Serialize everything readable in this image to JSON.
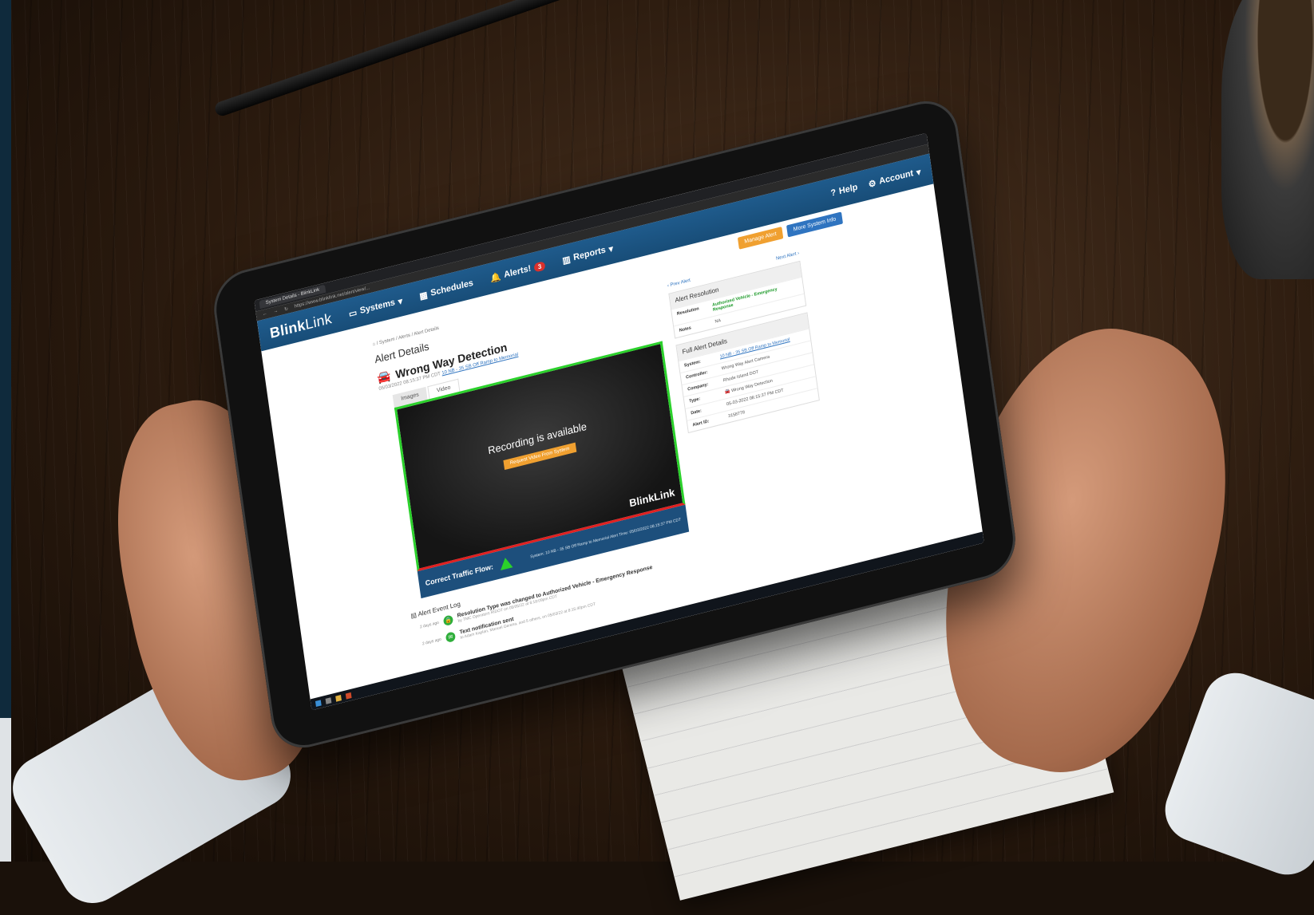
{
  "browser": {
    "tab_title": "System Details - BlinkLink",
    "url": "https://www.blinklink.net/alert/view/..."
  },
  "navbar": {
    "logo_bold": "Blink",
    "logo_light": "Link",
    "items": [
      {
        "label": "Systems",
        "icon": "drive-icon"
      },
      {
        "label": "Schedules",
        "icon": "calendar-icon"
      },
      {
        "label": "Alerts!",
        "icon": "bell-icon",
        "badge": "3"
      },
      {
        "label": "Reports",
        "icon": "bar-chart-icon"
      }
    ],
    "help": "Help",
    "account": "Account"
  },
  "actions": {
    "manage_alert": "Manage Alert",
    "more_system_info": "More System Info"
  },
  "breadcrumb": [
    "System",
    "Alerts",
    "Alert Details"
  ],
  "page": {
    "title": "Alert Details",
    "alert_title": "Wrong Way Detection",
    "alert_time": "05/03/2022 08:15:37 PM CDT",
    "alert_link": "10 NB - 35 SB Off Ramp to Memorial"
  },
  "media_tabs": [
    "Images",
    "Video"
  ],
  "video": {
    "message": "Recording is available",
    "button": "Request Video From System",
    "logo": "BlinkLink"
  },
  "flow": {
    "label": "Correct Traffic Flow:",
    "info": "System: 10 NB - 35 SB Off Ramp to Memorial    Alert Time: 05/03/2022 08:15:37 PM CDT"
  },
  "nav_links": {
    "prev": "Prev Alert",
    "next": "Next Alert"
  },
  "resolution": {
    "title": "Alert Resolution",
    "rows": [
      {
        "k": "Resolution",
        "v": "Authorized Vehicle - Emergency Response"
      },
      {
        "k": "Notes",
        "v": "NA"
      }
    ]
  },
  "full_details": {
    "title": "Full Alert Details",
    "rows": [
      {
        "k": "System:",
        "v": "10 NB - 35 SB Off Ramp to Memorial"
      },
      {
        "k": "Controller:",
        "v": "Wrong Way Alert Camera"
      },
      {
        "k": "Company:",
        "v": "Rhode Island DOT"
      },
      {
        "k": "Type:",
        "v": "Wrong Way Detection"
      },
      {
        "k": "Date:",
        "v": "05-03-2022 08:15:37 PM CDT"
      },
      {
        "k": "Alert ID:",
        "v": "3158778"
      }
    ]
  },
  "event_log": {
    "title": "Alert Event Log",
    "items": [
      {
        "ago": "2 days ago",
        "title": "Resolution Type was changed to Authorized Vehicle - Emergency Response",
        "sub": "by TMC Operators RIDOT on 05/05/22 at 6:18:09pm CDT"
      },
      {
        "ago": "2 days ago",
        "title": "Text notification sent",
        "sub": "to Adam Kaplan, Manuel Gerena, and 5 others, on 05/03/22 at 8:15:40pm CDT"
      }
    ]
  }
}
